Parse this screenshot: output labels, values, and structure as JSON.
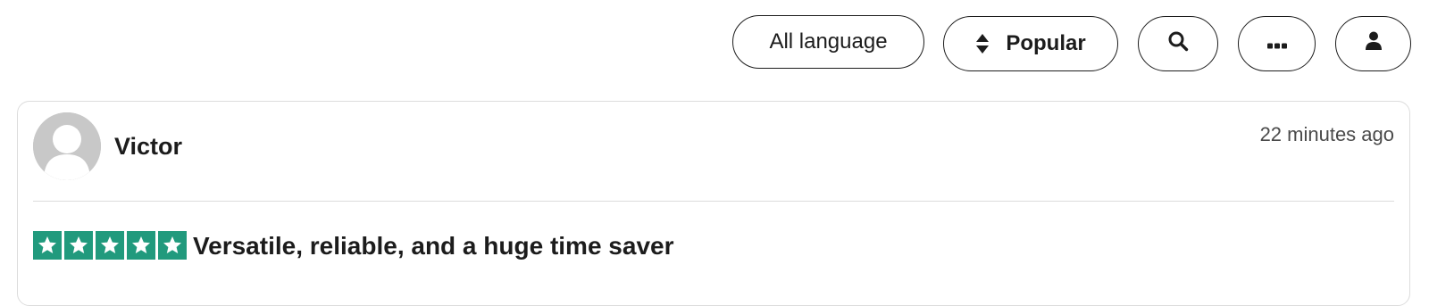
{
  "toolbar": {
    "language_label": "All language",
    "sort_label": "Popular",
    "icons": [
      "sort-arrows-icon",
      "search-icon",
      "more-dots-icon",
      "user-icon"
    ]
  },
  "review": {
    "reviewer_name": "Victor",
    "timestamp": "22 minutes ago",
    "rating": 5,
    "rating_max": 5,
    "title": "Versatile, reliable, and a huge time saver"
  },
  "colors": {
    "star_fill": "#219a7d",
    "avatar_placeholder": "#c8c8c8",
    "border": "#dcdcdc",
    "text": "#1c1c1c"
  }
}
